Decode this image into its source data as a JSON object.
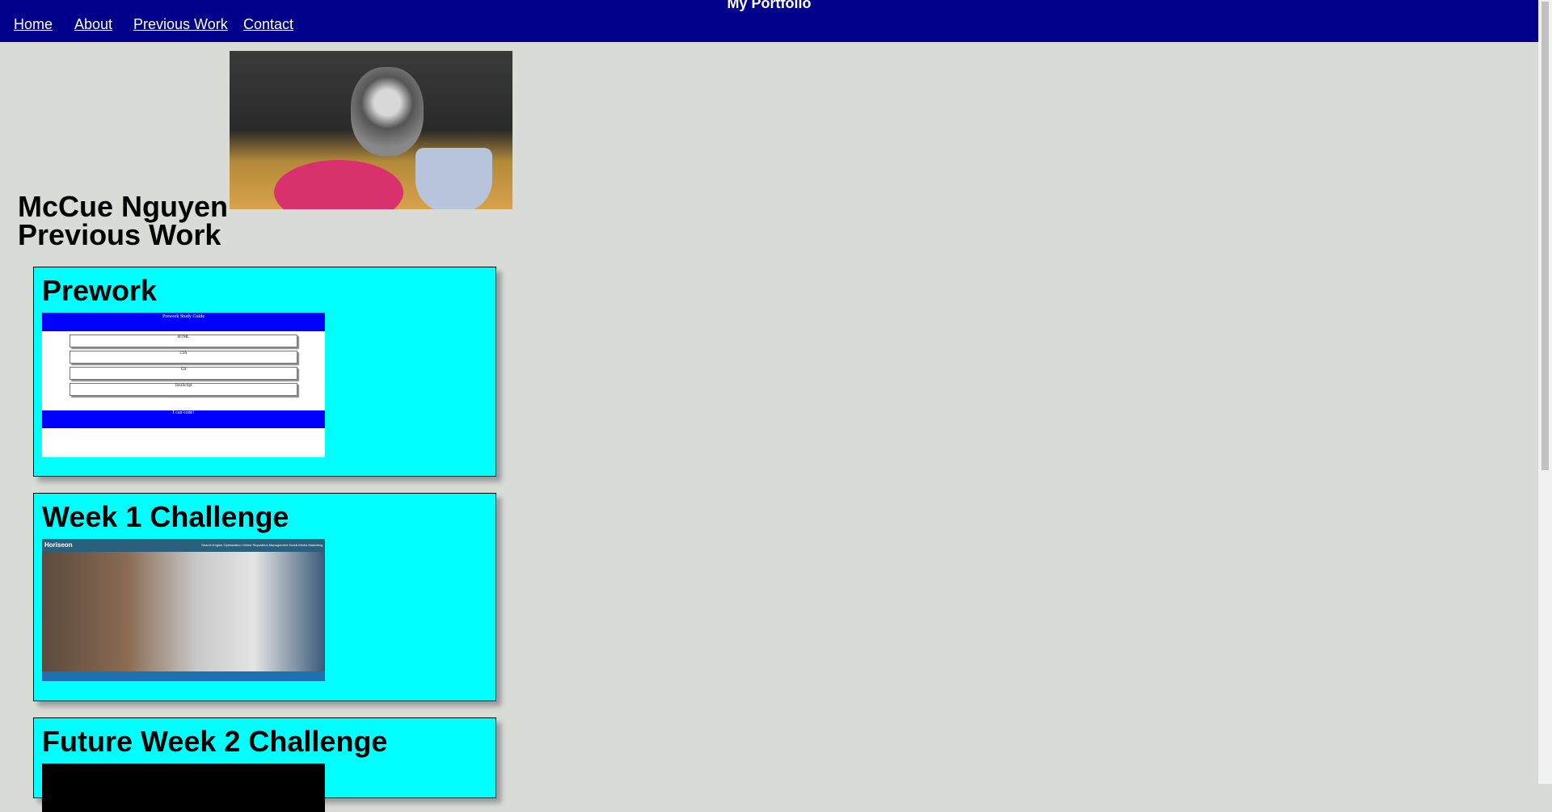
{
  "header": {
    "title": "My Portfolio",
    "nav": [
      "Home",
      "About",
      "Previous Work",
      "Contact"
    ]
  },
  "hero": {
    "name": "McCue Nguyen",
    "subtitle": "Previous Work"
  },
  "projects": [
    {
      "title": "Prework",
      "preview": {
        "heading": "Prework Study Guide",
        "sections": [
          "HTML",
          "CSS",
          "Git",
          "JavaScript"
        ],
        "footer": "I can code!"
      }
    },
    {
      "title": "Week 1 Challenge",
      "preview": {
        "brand": "Horiseon",
        "links": "Search Engine Optimization   Online Reputation Management   Social Media Marketing"
      }
    },
    {
      "title": "Future Week 2 Challenge"
    }
  ]
}
